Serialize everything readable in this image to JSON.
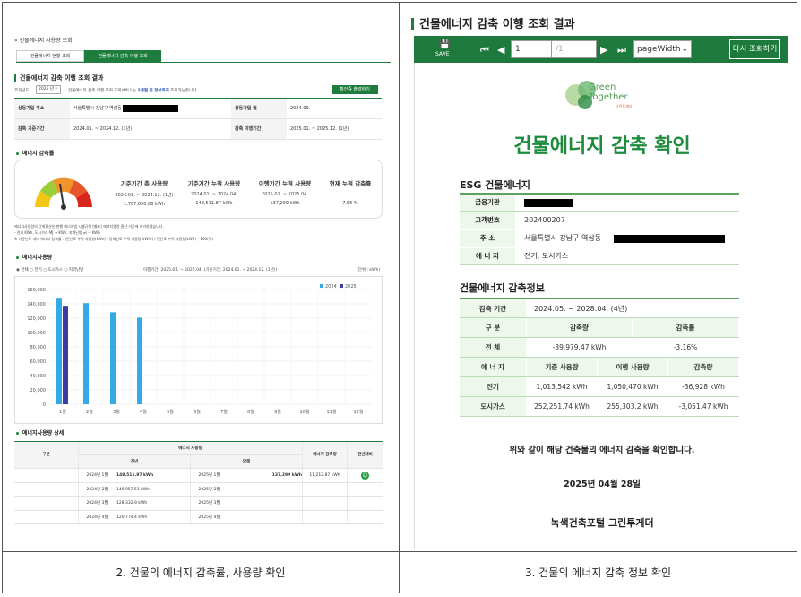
{
  "left": {
    "breadcrumb": "» 건물에너지 사용량 조회",
    "tabs": [
      "건물에너지 현황 조회",
      "건물에너지 감축 이행 조회"
    ],
    "section_title": "건물에너지 감축 이행 조회 결과",
    "year_label": "조회년도",
    "year_value": "2025 년",
    "info_text": "건물에너지 감축 이행 조회 조회서비스는",
    "info_highlight": "3개월 전 정보까지",
    "info_tail": "조회가능합니다.",
    "confirm_button": "확인증 출력하기",
    "info": {
      "addr_label": "상동가입 주소",
      "addr_value": "서울특별시 강남구 역삼동",
      "month_label": "상동가입 월",
      "month_value": "2024.09.",
      "base_label": "감축 기준기간",
      "base_value": "2024.01. ~ 2024.12. (1년)",
      "impl_label": "감축 이행기간",
      "impl_value": "2025.01. ~ 2025.12. (1년)"
    },
    "rate_title": "에너지 감축률",
    "stats": [
      {
        "title": "기준기간 총 사용량",
        "period": "2024.01. ~ 2024.12. (1년)",
        "value": "1,707,050.88 kWh"
      },
      {
        "title": "기준기간 누적 사용량",
        "period": "2024.01. ~ 2024.04.",
        "value": "148,511.87 kWh"
      },
      {
        "title": "이행기간 누적 사용량",
        "period": "2025.01. ~ 2025.04.",
        "value": "137,299 kWh"
      },
      {
        "title": "현재 누적 감축률",
        "period": "",
        "value": "7.55 %"
      }
    ],
    "notes": [
      "에너지사용량의 단위환산은 현행 에너지법 시행규칙 [별표] 에너지열량 환산 기준에 의거하였습니다.",
      "- 전기 KWh, 도시가스 MJ → KWh, 지역난방 ㎥ → KWh",
      "※ 기준년도 대비 에너지 감축률 : (전년도 누적 사용량(kWh) - 당해년도 누적 사용량(kWh)) / 전년도 누적 사용량(kWh) * 100(%)"
    ],
    "usage_title": "에너지사용량",
    "radios": "◉ 전체 ○ 전기 ○ 도시가스 ○ 지역난방",
    "period_note": "이행기간: 2025.01. ~ 2025.04. (기준기간: 2024.01. ~ 2024.12. (1년))",
    "unit": "(단위 : kWh)",
    "detail_title": "에너지사용량 상세",
    "detail_headers": {
      "kind": "구분",
      "usage": "에너지 사용량",
      "prev": "전년",
      "cur": "당해",
      "rate": "에너지 감축량",
      "cmp": "전년대비"
    },
    "detail_rows": [
      {
        "pm": "2024년 1월",
        "pv": "148,511.87 kWh",
        "cm": "2025년 1월",
        "cv": "137,299 kWh",
        "rate": "11,212.87 kWh"
      },
      {
        "pm": "2024년 2월",
        "pv": "140,957.51 kWh",
        "cm": "2025년 2월",
        "cv": "",
        "rate": ""
      },
      {
        "pm": "2024년 3월",
        "pv": "128,332.9 kWh",
        "cm": "2025년 3월",
        "cv": "",
        "rate": ""
      },
      {
        "pm": "2024년 4월",
        "pv": "120,774.4 kWh",
        "cm": "2025년 4월",
        "cv": "",
        "rate": ""
      }
    ]
  },
  "chart_data": {
    "type": "bar",
    "categories": [
      "1월",
      "2월",
      "3월",
      "4월",
      "5월",
      "6월",
      "7월",
      "8월",
      "9월",
      "10월",
      "11월",
      "12월"
    ],
    "series": [
      {
        "name": "2024",
        "values": [
          148500,
          141000,
          128300,
          120800,
          null,
          null,
          null,
          null,
          null,
          null,
          null,
          null
        ]
      },
      {
        "name": "2025",
        "values": [
          137300,
          null,
          null,
          null,
          null,
          null,
          null,
          null,
          null,
          null,
          null,
          null
        ]
      }
    ],
    "yticks": [
      "160,000",
      "140,000",
      "120,000",
      "100,000",
      "80,000",
      "60,000",
      "40,000",
      "20,000",
      "0"
    ],
    "ylim": [
      0,
      160000
    ],
    "colors": [
      "#35a9e6",
      "#3a3aa8"
    ],
    "legend": "top-right"
  },
  "right": {
    "title": "건물에너지 감축 이행 조회 결과",
    "save": "SAVE",
    "page_value": "1",
    "page_total": "/1",
    "zoom": "pageWidth",
    "retry_button": "다시 조회하기",
    "logo": {
      "line1": "Green",
      "line2": "Together",
      "kr": "그린투게더"
    },
    "doc_title": "건물에너지 감축 확인",
    "esg_title": "ESG 건물에너지",
    "rows": [
      {
        "label": "금융기관",
        "value": ""
      },
      {
        "label": "고객번호",
        "value": "202400207"
      },
      {
        "label": "주    소",
        "value": "서울특별시 강남구 역삼동"
      },
      {
        "label": "에 너 지",
        "value": "전기, 도시가스"
      }
    ],
    "info_title": "건물에너지 감축정보",
    "period_label": "감축 기간",
    "period_value": "2024.05. ~ 2028.04. (4년)",
    "kind_label": "구    분",
    "amount_label": "감축량",
    "rate_label": "감축률",
    "total_label": "전    체",
    "total_amount": "-39,979.47 kWh",
    "total_rate": "-3.16%",
    "energy_label": "에 너 지",
    "base_label": "기준 사용량",
    "impl_label": "이행 사용량",
    "red_label": "감축량",
    "energy_rows": [
      {
        "name": "전기",
        "base": "1,013,542 kWh",
        "impl": "1,050,470 kWh",
        "red": "-36,928 kWh"
      },
      {
        "name": "도시가스",
        "base": "252,251.74 kWh",
        "impl": "255,303.2 kWh",
        "red": "-3,051.47 kWh"
      }
    ],
    "confirm_text": "위와 같이 해당 건축물의 에너지 감축을 확인합니다.",
    "date": "2025년 04월 28일",
    "issuer": "녹색건축포털 그린투게더"
  },
  "captions": [
    "2. 건물의 에너지 감축률, 사용량 확인",
    "3. 건물의 에너지 감축 정보 확인"
  ]
}
